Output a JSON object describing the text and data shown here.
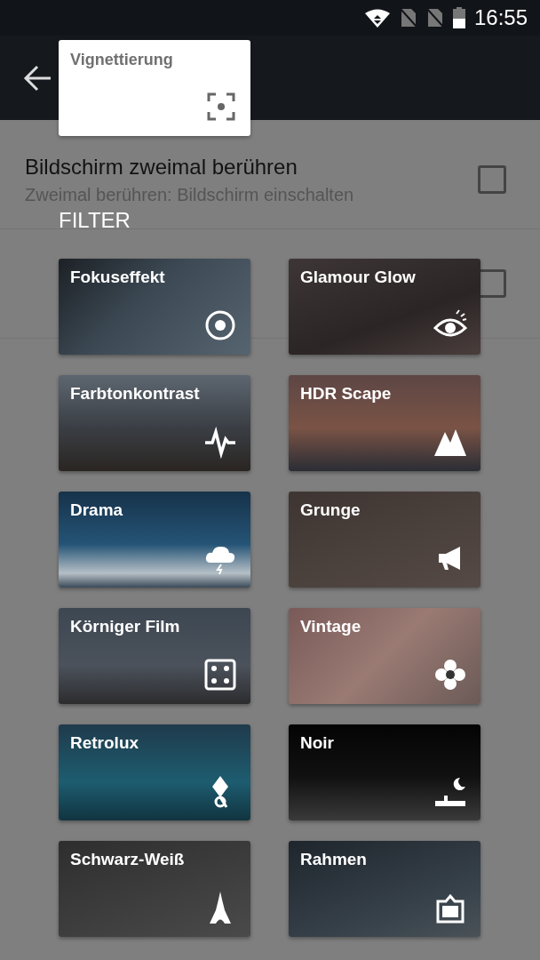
{
  "status_bar": {
    "time": "16:55"
  },
  "settings": [
    {
      "title": "Bildschirm zweimal berühren",
      "summary": "Zweimal berühren: Bildschirm einschalten",
      "checked": false
    },
    {
      "checked": false
    }
  ],
  "popup": {
    "title": "Vignettierung"
  },
  "filter_heading": "FILTER",
  "filters": [
    {
      "label": "Fokuseffekt"
    },
    {
      "label": "Glamour Glow"
    },
    {
      "label": "Farbtonkontrast"
    },
    {
      "label": "HDR Scape"
    },
    {
      "label": "Drama"
    },
    {
      "label": "Grunge"
    },
    {
      "label": "Körniger Film"
    },
    {
      "label": "Vintage"
    },
    {
      "label": "Retrolux"
    },
    {
      "label": "Noir"
    },
    {
      "label": "Schwarz-Weiß"
    },
    {
      "label": "Rahmen"
    }
  ]
}
